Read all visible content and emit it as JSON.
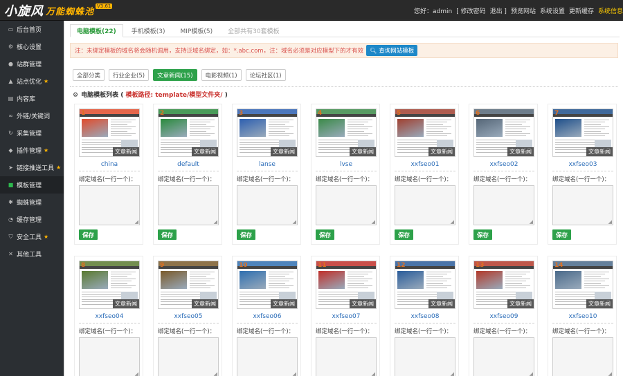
{
  "header": {
    "logo_main": "小旋风",
    "logo_sub": "万能蜘蛛池",
    "logo_version": "V3.61",
    "greeting": "您好：admin",
    "links": [
      "[ 修改密码",
      "退出 ]",
      "预览网站",
      "系统设置",
      "更新缓存"
    ],
    "highlight": "系统信息"
  },
  "sidebar": {
    "items": [
      {
        "icon": "monitor-icon",
        "glyph": "▭",
        "label": "后台首页",
        "star": false
      },
      {
        "icon": "gear-icon",
        "glyph": "⚙",
        "label": "核心设置",
        "star": false
      },
      {
        "icon": "user-icon",
        "glyph": "●",
        "label": "站群管理",
        "star": false
      },
      {
        "icon": "chart-icon",
        "glyph": "▲",
        "label": "站点优化",
        "star": true
      },
      {
        "icon": "document-icon",
        "glyph": "▤",
        "label": "内容库",
        "star": false
      },
      {
        "icon": "link-icon",
        "glyph": "∞",
        "label": "外链/关键词",
        "star": false
      },
      {
        "icon": "refresh-icon",
        "glyph": "↻",
        "label": "采集管理",
        "star": false
      },
      {
        "icon": "plugin-icon",
        "glyph": "◆",
        "label": "插件管理",
        "star": true
      },
      {
        "icon": "send-icon",
        "glyph": "➤",
        "label": "链接推送工具",
        "star": true
      },
      {
        "icon": "grid-icon",
        "glyph": "■",
        "label": "模板管理",
        "star": false,
        "active": true
      },
      {
        "icon": "spider-icon",
        "glyph": "✱",
        "label": "蜘蛛管理",
        "star": false
      },
      {
        "icon": "cache-icon",
        "glyph": "◔",
        "label": "缓存管理",
        "star": false
      },
      {
        "icon": "shield-icon",
        "glyph": "⛉",
        "label": "安全工具",
        "star": true
      },
      {
        "icon": "tools-icon",
        "glyph": "✕",
        "label": "其他工具",
        "star": false
      }
    ]
  },
  "tabs": [
    {
      "label": "电脑模板(22)",
      "active": true
    },
    {
      "label": "手机模板(3)",
      "active": false
    },
    {
      "label": "MIP模板(5)",
      "active": false
    },
    {
      "label": "全部共有30套模板",
      "active": false,
      "muted": true
    }
  ],
  "notice": {
    "text": "注：未绑定模板的域名将会随机调用，支持泛域名绑定，如：*.abc.com，注：域名必须是对应模型下的才有效",
    "button": "查询网站模板"
  },
  "filters": [
    {
      "label": "全部分类",
      "active": false
    },
    {
      "label": "行业企业(5)",
      "active": false
    },
    {
      "label": "文章新闻(15)",
      "active": true
    },
    {
      "label": "电影视频(1)",
      "active": false
    },
    {
      "label": "论坛社区(1)",
      "active": false
    }
  ],
  "list_title": {
    "prefix": "电脑模板列表 (",
    "path": " 模板路径: template/模型文件夹/ ",
    "suffix": ")"
  },
  "card_common": {
    "badge": "文章新闻",
    "bind_label": "绑定域名(一行一个)：",
    "save": "保存"
  },
  "templates": [
    {
      "num": "1",
      "name": "china",
      "theme": "#e14b2b"
    },
    {
      "num": "2",
      "name": "default",
      "theme": "#2a8a3c"
    },
    {
      "num": "3",
      "name": "lanse",
      "theme": "#2d5fb0"
    },
    {
      "num": "4",
      "name": "lvse",
      "theme": "#3b8a48"
    },
    {
      "num": "5",
      "name": "xxfseo01",
      "theme": "#a04030"
    },
    {
      "num": "6",
      "name": "xxfseo02",
      "theme": "#556677"
    },
    {
      "num": "7",
      "name": "xxfseo03",
      "theme": "#1e4f8a"
    },
    {
      "num": "8",
      "name": "xxfseo04",
      "theme": "#5a7a30"
    },
    {
      "num": "9",
      "name": "xxfseo05",
      "theme": "#7a5a2a"
    },
    {
      "num": "10",
      "name": "xxfseo06",
      "theme": "#2f6fb0"
    },
    {
      "num": "11",
      "name": "xxfseo07",
      "theme": "#c0302a"
    },
    {
      "num": "12",
      "name": "xxfseo08",
      "theme": "#2a5c9a"
    },
    {
      "num": "13",
      "name": "xxfseo09",
      "theme": "#b33a2a"
    },
    {
      "num": "14",
      "name": "xxfseo10",
      "theme": "#4a6a8a"
    }
  ]
}
